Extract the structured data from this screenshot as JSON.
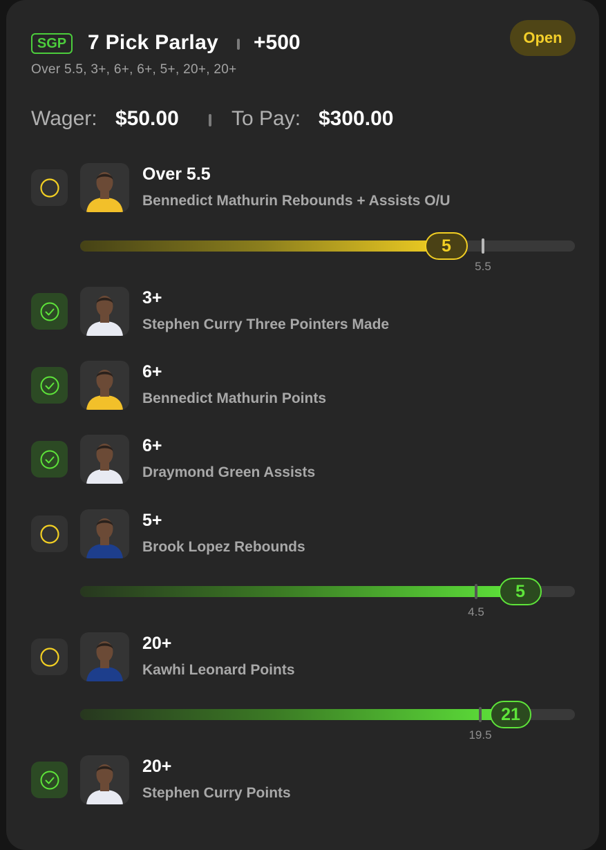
{
  "header": {
    "badge": "SGP",
    "title": "7 Pick Parlay",
    "odds": "+500",
    "summary": "Over 5.5, 3+, 6+, 6+, 5+, 20+, 20+",
    "status": "Open"
  },
  "wager": {
    "label": "Wager:",
    "value": "$50.00"
  },
  "to_pay": {
    "label": "To Pay:",
    "value": "$300.00"
  },
  "legs": [
    {
      "line": "Over 5.5",
      "market": "Bennedict Mathurin Rebounds + Assists O/U",
      "status": "pending",
      "team_color": "#f2c02a",
      "progress": {
        "current": "5",
        "target": "5.5",
        "fraction": 0.74,
        "color": "yellow"
      }
    },
    {
      "line": "3+",
      "market": "Stephen Curry Three Pointers Made",
      "status": "won",
      "team_color": "#e8eaf2"
    },
    {
      "line": "6+",
      "market": "Bennedict Mathurin Points",
      "status": "won",
      "team_color": "#f2c02a"
    },
    {
      "line": "6+",
      "market": "Draymond Green Assists",
      "status": "won",
      "team_color": "#e8eaf2"
    },
    {
      "line": "5+",
      "market": "Brook Lopez Rebounds",
      "status": "pending",
      "team_color": "#1d3e8c",
      "progress": {
        "current": "5",
        "target": "4.5",
        "fraction": 0.89,
        "color": "green"
      }
    },
    {
      "line": "20+",
      "market": "Kawhi Leonard Points",
      "status": "pending",
      "team_color": "#1d3e8c",
      "progress": {
        "current": "21",
        "target": "19.5",
        "fraction": 0.87,
        "color": "green"
      }
    },
    {
      "line": "20+",
      "market": "Stephen Curry Points",
      "status": "won",
      "team_color": "#e8eaf2"
    }
  ],
  "colors": {
    "pending": "#f2cf23",
    "won": "#5ee43a",
    "background": "#262626"
  }
}
